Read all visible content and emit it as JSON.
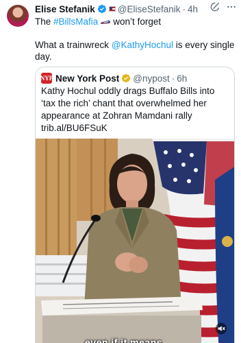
{
  "tweet": {
    "author_name": "Elise Stefanik",
    "handle": "@EliseStefanik",
    "separator": "·",
    "time": "4h",
    "line1_prefix": "The ",
    "hashtag": "#BillsMafia",
    "line1_suffix": "won’t forget",
    "line2_prefix": "What a trainwreck ",
    "mention": "@KathyHochul",
    "line2_suffix": " is every single day."
  },
  "quoted": {
    "author_name": "New York Post",
    "handle": "@nypost",
    "separator": "·",
    "time": "6h",
    "logo_text": "NYP",
    "text": "Kathy Hochul oddly drags Buffalo Bills into ‘tax the rich’ chant that overwhelmed her appearance at Zohran Mamdani rally trib.al/BU6FSuK",
    "caption": "even if it means"
  },
  "colors": {
    "link": "#1d9bf0",
    "text": "#0f1419",
    "secondary": "#536471",
    "verified_blue": "#1d9bf0",
    "verified_gold": "#e2b719",
    "nyp_red": "#d1232a"
  },
  "icons": {
    "verified": "verified-badge-icon",
    "flag": "us-flag-icon",
    "grok": "grok-icon",
    "more": "more-icon",
    "train": "train-emoji-icon",
    "gold_verified": "gold-verified-icon",
    "speaker": "speaker-muted-icon"
  }
}
